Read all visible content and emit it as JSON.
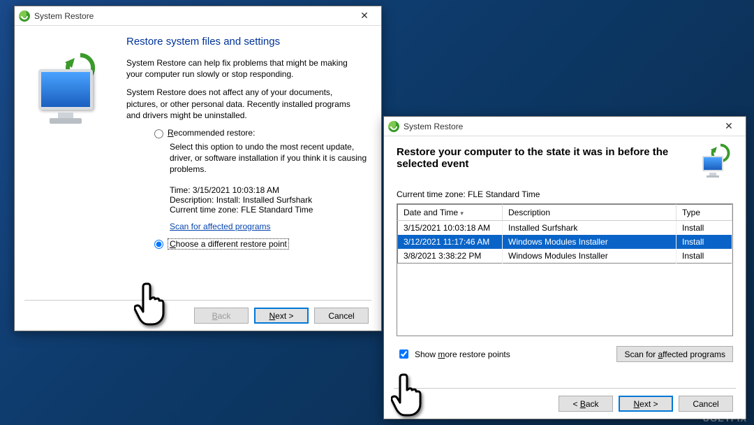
{
  "watermark": "UGETFIX",
  "window1": {
    "title": "System Restore",
    "heading": "Restore system files and settings",
    "para1": "System Restore can help fix problems that might be making your computer run slowly or stop responding.",
    "para2": "System Restore does not affect any of your documents, pictures, or other personal data. Recently installed programs and drivers might be uninstalled.",
    "opt_recommended_label": "Recommended restore:",
    "opt_recommended_desc": "Select this option to undo the most recent update, driver, or software installation if you think it is causing problems.",
    "info_time_label": "Time:",
    "info_time_value": "3/15/2021 10:03:18 AM",
    "info_desc_label": "Description:",
    "info_desc_value": "Install: Installed Surfshark",
    "info_tz_label": "Current time zone:",
    "info_tz_value": "FLE Standard Time",
    "scan_link": "Scan for affected programs",
    "opt_choose_label": "Choose a different restore point",
    "btn_back": "< Back",
    "btn_next": "Next >",
    "btn_cancel": "Cancel"
  },
  "window2": {
    "title": "System Restore",
    "heading": "Restore your computer to the state it was in before the selected event",
    "tz_line": "Current time zone: FLE Standard Time",
    "col_date": "Date and Time",
    "col_desc": "Description",
    "col_type": "Type",
    "rows": [
      {
        "date": "3/15/2021 10:03:18 AM",
        "desc": "Installed Surfshark",
        "type": "Install"
      },
      {
        "date": "3/12/2021 11:17:46 AM",
        "desc": "Windows Modules Installer",
        "type": "Install"
      },
      {
        "date": "3/8/2021 3:38:22 PM",
        "desc": "Windows Modules Installer",
        "type": "Install"
      }
    ],
    "show_more_label": "Show more restore points",
    "scan_btn": "Scan for affected programs",
    "btn_back": "< Back",
    "btn_next": "Next >",
    "btn_cancel": "Cancel"
  }
}
